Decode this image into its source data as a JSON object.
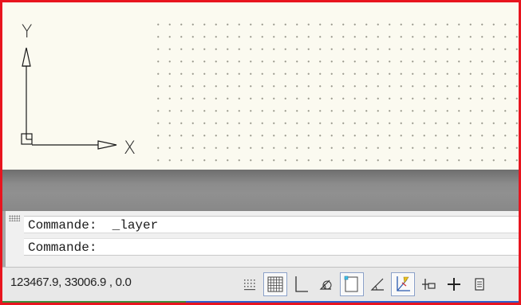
{
  "ucs": {
    "y_label": "Y",
    "x_label": "X"
  },
  "command_line": {
    "line1_prompt": "Commande:",
    "line1_command": "_layer",
    "line2_prompt": "Commande:"
  },
  "status_bar": {
    "coordinates": "123467.9, 33006.9 , 0.0",
    "toggles": [
      {
        "icon": "snap-icon",
        "active": false
      },
      {
        "icon": "grid-icon",
        "active": true
      },
      {
        "icon": "ortho-icon",
        "active": false
      },
      {
        "icon": "polar-icon",
        "active": false
      },
      {
        "icon": "osnap-icon",
        "active": true
      },
      {
        "icon": "otrack-icon",
        "active": false
      },
      {
        "icon": "ducs-icon",
        "active": true
      },
      {
        "icon": "dyn-icon",
        "active": false
      },
      {
        "icon": "lwt-icon",
        "active": false
      },
      {
        "icon": "qp-icon",
        "active": false
      }
    ]
  },
  "colors": {
    "canvas_bg": "#fbfaf0",
    "frame_border": "#e8141e",
    "grid_dot": "#9a9a8e"
  }
}
